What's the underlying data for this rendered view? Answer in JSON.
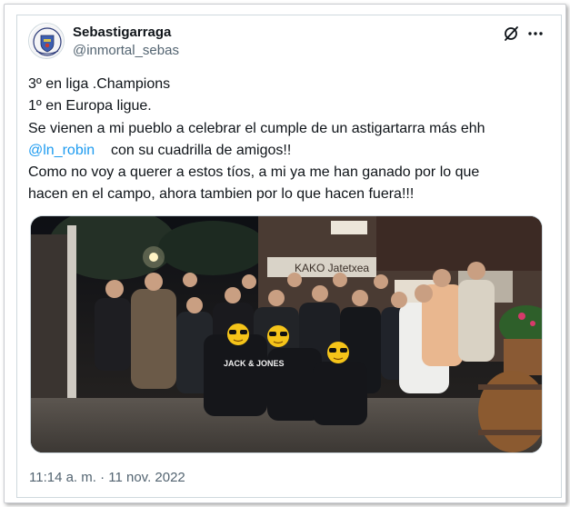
{
  "user": {
    "display_name": "Sebastigarraga",
    "handle": "@inmortal_sebas"
  },
  "icons": {
    "grok": "grok-icon",
    "more": "more-options-icon"
  },
  "tweet": {
    "line1": "3º en liga .Champions",
    "line2": "1º en Europa ligue.",
    "line3": "Se vienen a mi pueblo a celebrar el cumple de un astigartarra más ehh",
    "mention": "@ln_robin",
    "line4_rest": "con su cuadrilla de amigos!!",
    "line5": "Como no voy a querer a estos tíos, a mi ya me han ganado por lo que",
    "line6": "hacen en el campo, ahora tambien por lo que hacen fuera!!!"
  },
  "photo": {
    "sign_text": "KAKO Jatetxea",
    "shirt_text": "JACK & JONES"
  },
  "timestamp": "11:14 a. m. · 11 nov. 2022",
  "colors": {
    "text": "#0f1419",
    "secondary": "#536471",
    "link": "#1d9bf0",
    "border": "#cfd9de"
  }
}
